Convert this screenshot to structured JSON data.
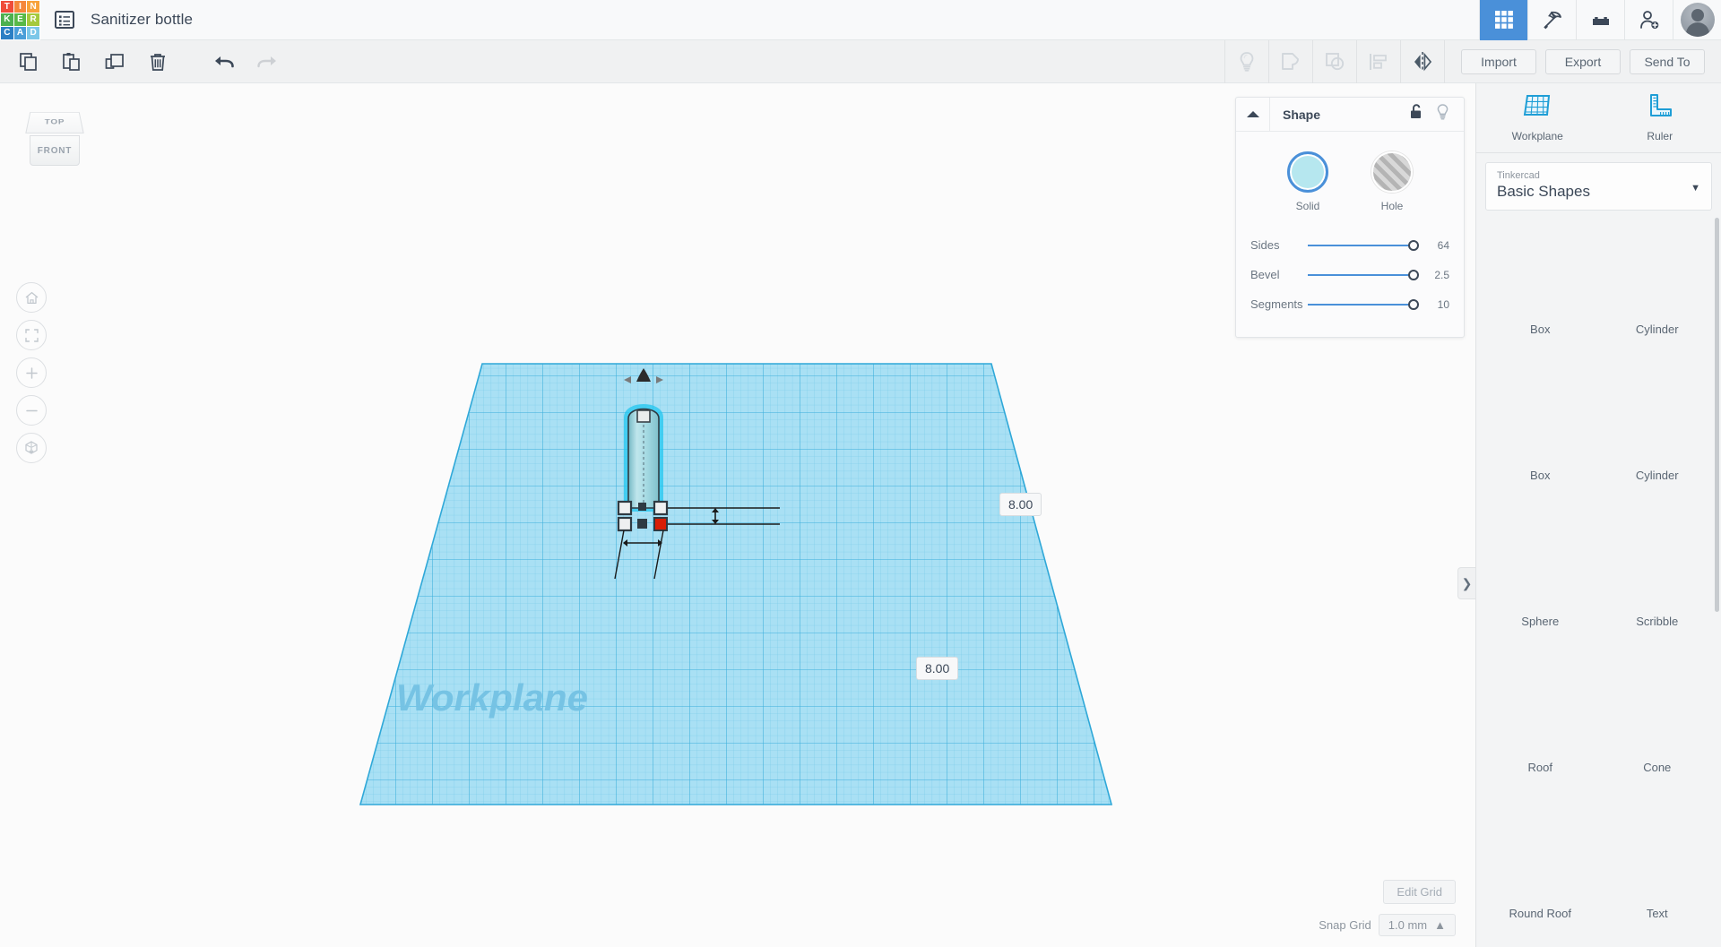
{
  "app": {
    "brand_letters": [
      "T",
      "I",
      "N",
      "K",
      "E",
      "R",
      "C",
      "A",
      "D"
    ],
    "brand_colors": [
      "#ef4c3a",
      "#f5873b",
      "#f7a23a",
      "#4cb050",
      "#58b947",
      "#a5c93c",
      "#2b7fc4",
      "#4a9ed8",
      "#7cc7e8"
    ],
    "project_title": "Sanitizer bottle",
    "doc_icon": "document-list-icon"
  },
  "topbar_icons": [
    {
      "name": "grid-apps-icon",
      "active": true
    },
    {
      "name": "codeblocks-pickaxe-icon",
      "active": false
    },
    {
      "name": "blocks-brick-icon",
      "active": false
    },
    {
      "name": "add-user-icon",
      "active": false
    }
  ],
  "toolbar": {
    "left_icons": [
      "copy-icon",
      "paste-icon",
      "duplicate-icon",
      "delete-trash-icon",
      "undo-icon",
      "redo-icon"
    ],
    "right_icons": [
      "lightbulb-icon",
      "group-icon",
      "ungroup-icon",
      "align-icon",
      "mirror-icon"
    ],
    "import_label": "Import",
    "export_label": "Export",
    "send_to_label": "Send To"
  },
  "viewcube": {
    "top_label": "TOP",
    "front_label": "FRONT"
  },
  "nav_buttons": [
    {
      "name": "home-view-icon"
    },
    {
      "name": "fit-to-view-icon"
    },
    {
      "name": "zoom-in-icon"
    },
    {
      "name": "zoom-out-icon"
    },
    {
      "name": "orthographic-toggle-icon"
    }
  ],
  "canvas": {
    "workplane_watermark": "Workplane",
    "dimension_height": "8.00",
    "dimension_width": "8.00",
    "edit_grid_label": "Edit Grid",
    "snap_grid_label": "Snap Grid",
    "snap_grid_value": "1.0 mm",
    "collapse_tab": "❯",
    "grid_color": "#5bc0e8",
    "plane_fill": "#9fdcf2",
    "object_color": "#9fd7df"
  },
  "inspector": {
    "title": "Shape",
    "collapse_icon": "collapse-triangle-icon",
    "lock_icon": "unlock-icon",
    "visibility_icon": "lightbulb-icon",
    "solid_label": "Solid",
    "hole_label": "Hole",
    "solid_color": "#b6e7ef",
    "accent_color": "#4a90d9",
    "sliders": [
      {
        "name": "Sides",
        "value": "64",
        "fill_pct": 86
      },
      {
        "name": "Bevel",
        "value": "2.5",
        "fill_pct": 86
      },
      {
        "name": "Segments",
        "value": "10",
        "fill_pct": 86
      }
    ]
  },
  "right_panel": {
    "tools": [
      {
        "label": "Workplane",
        "icon": "workplane-grid-icon"
      },
      {
        "label": "Ruler",
        "icon": "ruler-icon"
      }
    ],
    "library_owner": "Tinkercad",
    "library_name": "Basic Shapes",
    "caret_icon": "chevron-down-icon",
    "shapes": [
      {
        "label": "Box",
        "kind": "box",
        "color": "#b9bec4",
        "hole": true
      },
      {
        "label": "Cylinder",
        "kind": "cylinder",
        "color": "#b9bec4",
        "hole": true
      },
      {
        "label": "Box",
        "kind": "box",
        "color": "#cc2028",
        "hole": false
      },
      {
        "label": "Cylinder",
        "kind": "cylinder",
        "color": "#e8912a",
        "hole": false
      },
      {
        "label": "Sphere",
        "kind": "sphere",
        "color": "#1290c4",
        "hole": false
      },
      {
        "label": "Scribble",
        "kind": "scribble",
        "color": "#9cc3dd",
        "hole": false
      },
      {
        "label": "Roof",
        "kind": "roof",
        "color": "#3aa93a",
        "hole": false
      },
      {
        "label": "Cone",
        "kind": "cone",
        "color": "#8e3fa8",
        "hole": false
      },
      {
        "label": "Round Roof",
        "kind": "roundroof",
        "color": "#3fb8bf",
        "hole": false
      },
      {
        "label": "Text",
        "kind": "text",
        "color": "#c8202c",
        "hole": false
      }
    ]
  }
}
